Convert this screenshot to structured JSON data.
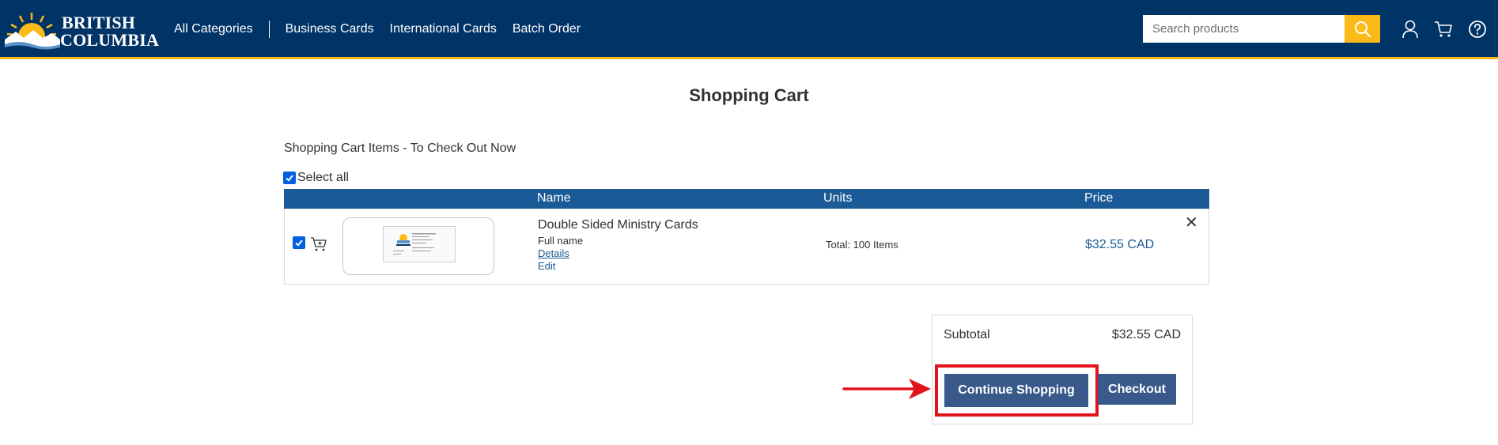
{
  "header": {
    "logo_line1": "BRITISH",
    "logo_line2": "COLUMBIA",
    "nav": [
      "All Categories",
      "Business Cards",
      "International Cards",
      "Batch Order"
    ],
    "search_placeholder": "Search products",
    "icons": [
      "search-icon",
      "user-icon",
      "cart-icon",
      "help-icon"
    ]
  },
  "page": {
    "title": "Shopping Cart",
    "section_label": "Shopping Cart Items - To Check Out Now",
    "select_all": "Select all"
  },
  "table": {
    "columns": [
      "Name",
      "Units",
      "Price"
    ],
    "rows": [
      {
        "name": "Double Sided Ministry Cards",
        "subtitle": "Full name",
        "details_link": "Details",
        "edit_link": "Edit",
        "units": "Total: 100 Items",
        "price": "$32.55 CAD",
        "remove": "✕",
        "checked": true
      }
    ]
  },
  "summary": {
    "subtotal_label": "Subtotal",
    "subtotal_value": "$32.55 CAD",
    "continue_label": "Continue Shopping",
    "checkout_label": "Checkout"
  },
  "colors": {
    "header_bg": "#003366",
    "accent": "#fcba19",
    "table_head": "#1a5a96",
    "button": "#38598a",
    "highlight": "#e2131d"
  }
}
